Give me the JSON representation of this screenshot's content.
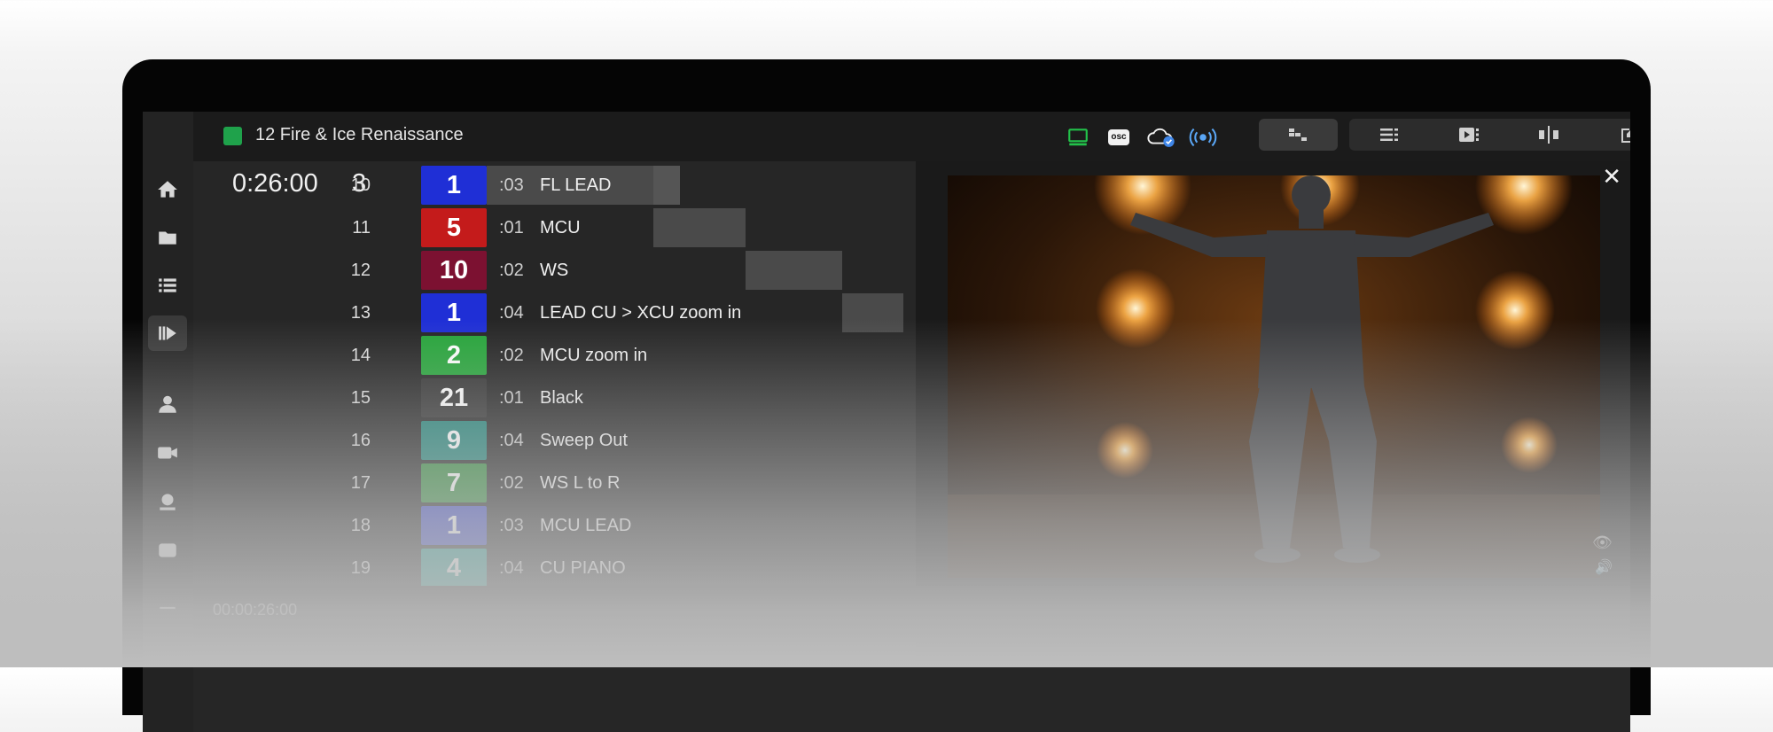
{
  "show": {
    "status_color": "#1fa24b",
    "title": "12  Fire & Ice  Renaissance"
  },
  "header": {
    "osc_label": "osc",
    "icons": [
      "monitor-icon",
      "osc-icon",
      "cloud-check-icon",
      "broadcast-icon"
    ],
    "view_buttons": [
      "shot-grid-view-icon",
      "list-view-icon",
      "preview-view-icon",
      "split-view-icon",
      "edit-icon"
    ]
  },
  "sidebar": {
    "items": [
      "home-icon",
      "folder-icon",
      "list-icon",
      "play-queue-icon",
      "user-icon",
      "camera-icon",
      "robotic-camera-icon",
      "osc-icon",
      "more-icon"
    ]
  },
  "status": {
    "timer": "0:26:00",
    "count": "3"
  },
  "shots": [
    {
      "num": "10",
      "cam": "1",
      "color": "#1f2fd6",
      "dur": ":03",
      "desc": "FL LEAD"
    },
    {
      "num": "11",
      "cam": "5",
      "color": "#c41b1b",
      "dur": ":01",
      "desc": "MCU"
    },
    {
      "num": "12",
      "cam": "10",
      "color": "#7c1131",
      "dur": ":02",
      "desc": "WS"
    },
    {
      "num": "13",
      "cam": "1",
      "color": "#1f2fd6",
      "dur": ":04",
      "desc": "LEAD CU > XCU zoom in"
    },
    {
      "num": "14",
      "cam": "2",
      "color": "#26a53a",
      "dur": ":02",
      "desc": "MCU zoom in"
    },
    {
      "num": "15",
      "cam": "21",
      "color": "#333333",
      "dur": ":01",
      "desc": "Black"
    },
    {
      "num": "16",
      "cam": "9",
      "color": "#1f8277",
      "dur": ":04",
      "desc": "Sweep Out"
    },
    {
      "num": "17",
      "cam": "7",
      "color": "#2f8a3a",
      "dur": ":02",
      "desc": "WS L to R"
    },
    {
      "num": "18",
      "cam": "1",
      "color": "#3c48c7",
      "dur": ":03",
      "desc": "MCU LEAD"
    },
    {
      "num": "19",
      "cam": "4",
      "color": "#1c9a8f",
      "dur": ":04",
      "desc": "CU PIANO"
    }
  ],
  "preview": {
    "close_label": "✕"
  },
  "timeline": {
    "time": "00:00:26:00"
  }
}
